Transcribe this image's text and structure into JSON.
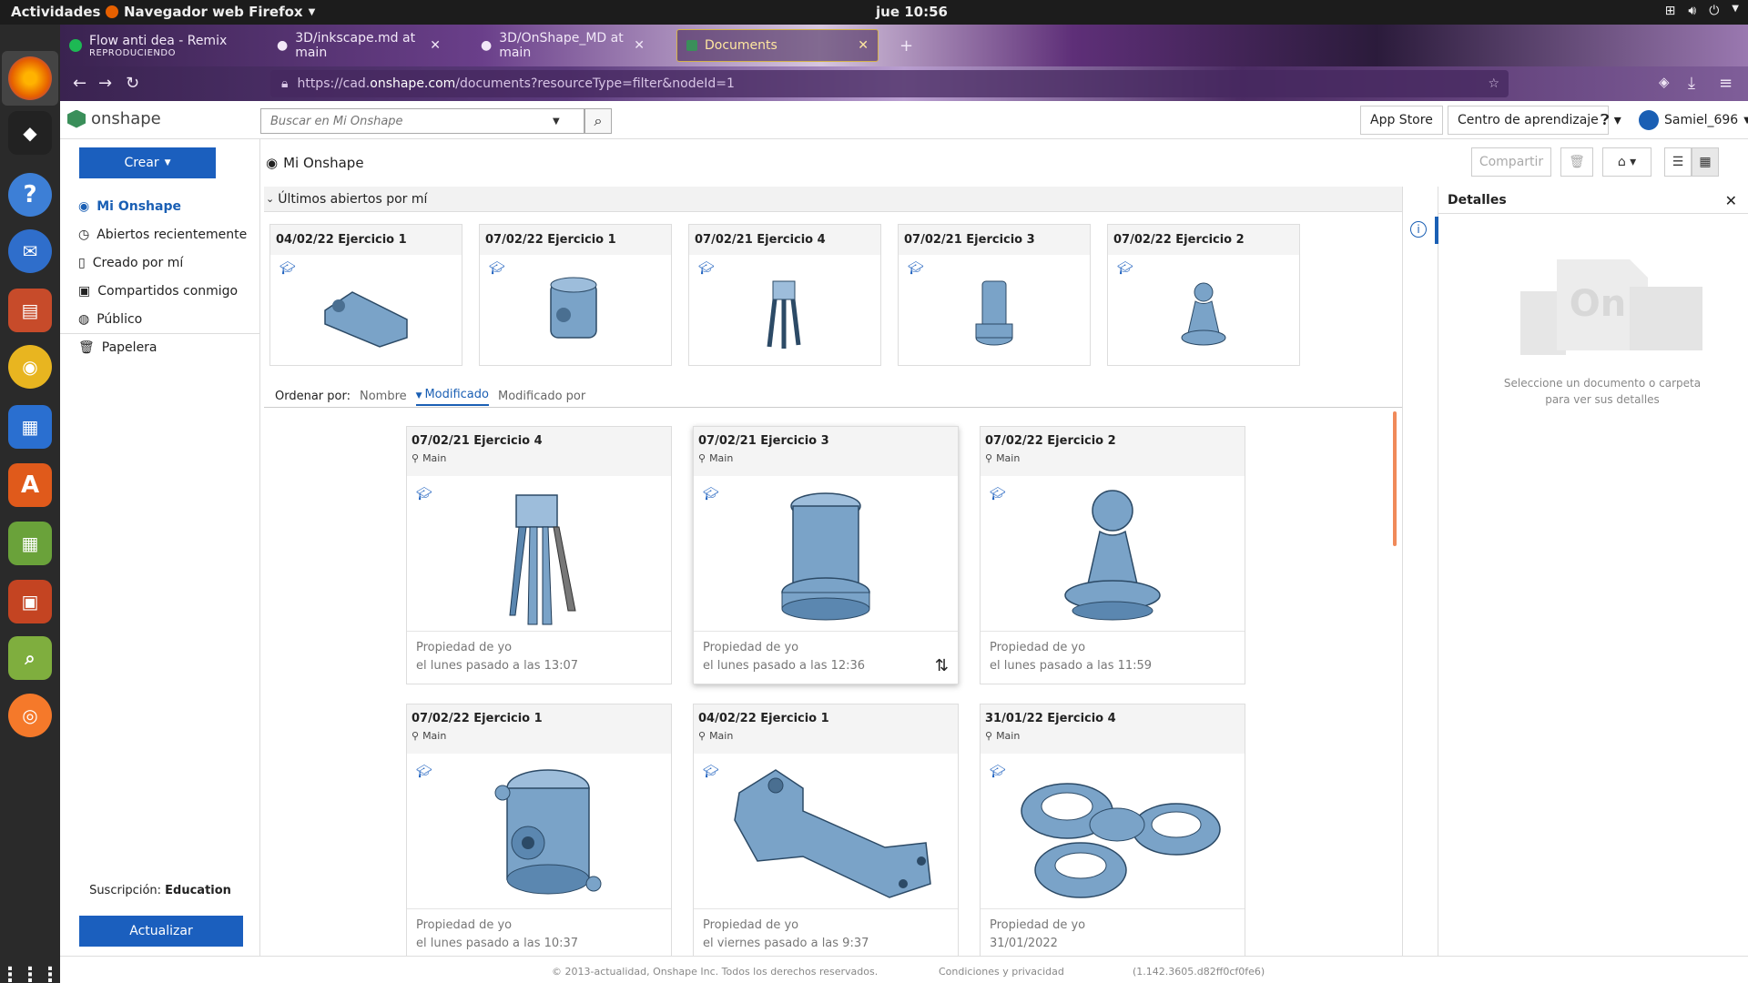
{
  "system": {
    "activities": "Actividades",
    "app_name": "Navegador web Firefox",
    "clock": "jue 10:56"
  },
  "browser": {
    "tabs": [
      {
        "title": "Flow anti dea - Remix",
        "sub": "REPRODUCIENDO"
      },
      {
        "title": "3D/inkscape.md at main"
      },
      {
        "title": "3D/OnShape_MD at main"
      },
      {
        "title": "Documents"
      }
    ],
    "url_prefix": "https://cad.",
    "url_host": "onshape.com",
    "url_path": "/documents?resourceType=filter&nodeId=1"
  },
  "header": {
    "logo": "onshape",
    "search_placeholder": "Buscar en Mi Onshape",
    "app_store": "App Store",
    "learning": "Centro de aprendizaje",
    "user": "Samiel_696"
  },
  "sidebar": {
    "create": "Crear",
    "items": [
      {
        "label": "Mi Onshape",
        "icon": "user-circle-icon"
      },
      {
        "label": "Abiertos recientemente",
        "icon": "clock-icon"
      },
      {
        "label": "Creado por mí",
        "icon": "document-icon"
      },
      {
        "label": "Compartidos conmigo",
        "icon": "shared-icon"
      },
      {
        "label": "Público",
        "icon": "globe-icon"
      },
      {
        "label": "Papelera",
        "icon": "trash-icon"
      }
    ],
    "subscription_label": "Suscripción:",
    "subscription_value": "Education",
    "upgrade": "Actualizar"
  },
  "toolbar": {
    "title": "Mi Onshape",
    "share": "Compartir"
  },
  "recent": {
    "heading": "Últimos abiertos por mí",
    "items": [
      {
        "title": "04/02/22 Ejercicio 1"
      },
      {
        "title": "07/02/22 Ejercicio 1"
      },
      {
        "title": "07/02/21 Ejercicio 4"
      },
      {
        "title": "07/02/21 Ejercicio 3"
      },
      {
        "title": "07/02/22 Ejercicio 2"
      }
    ]
  },
  "sort": {
    "label": "Ordenar por:",
    "options": [
      "Nombre",
      "Modificado",
      "Modificado por"
    ],
    "active": "Modificado"
  },
  "documents": [
    {
      "title": "07/02/21 Ejercicio 4",
      "branch": "Main",
      "owner": "Propiedad de yo",
      "modified": "el lunes pasado a las 13:07"
    },
    {
      "title": "07/02/21 Ejercicio 3",
      "branch": "Main",
      "owner": "Propiedad de yo",
      "modified": "el lunes pasado a las 12:36"
    },
    {
      "title": "07/02/22 Ejercicio 2",
      "branch": "Main",
      "owner": "Propiedad de yo",
      "modified": "el lunes pasado a las 11:59"
    },
    {
      "title": "07/02/22 Ejercicio 1",
      "branch": "Main",
      "owner": "Propiedad de yo",
      "modified": "el lunes pasado a las 10:37"
    },
    {
      "title": "04/02/22 Ejercicio 1",
      "branch": "Main",
      "owner": "Propiedad de yo",
      "modified": "el viernes pasado a las 9:37"
    },
    {
      "title": "31/01/22 Ejercicio 4",
      "branch": "Main",
      "owner": "Propiedad de yo",
      "modified": "31/01/2022"
    }
  ],
  "details": {
    "title": "Detalles",
    "hint": "Seleccione un documento o carpeta para ver sus detalles"
  },
  "footer": {
    "copyright": "© 2013-actualidad, Onshape Inc. Todos los derechos reservados.",
    "terms": "Condiciones y privacidad",
    "version": "(1.142.3605.d82ff0cf0fe6)"
  },
  "colors": {
    "accent": "#1b5fbe",
    "part": "#7aa3c8"
  }
}
